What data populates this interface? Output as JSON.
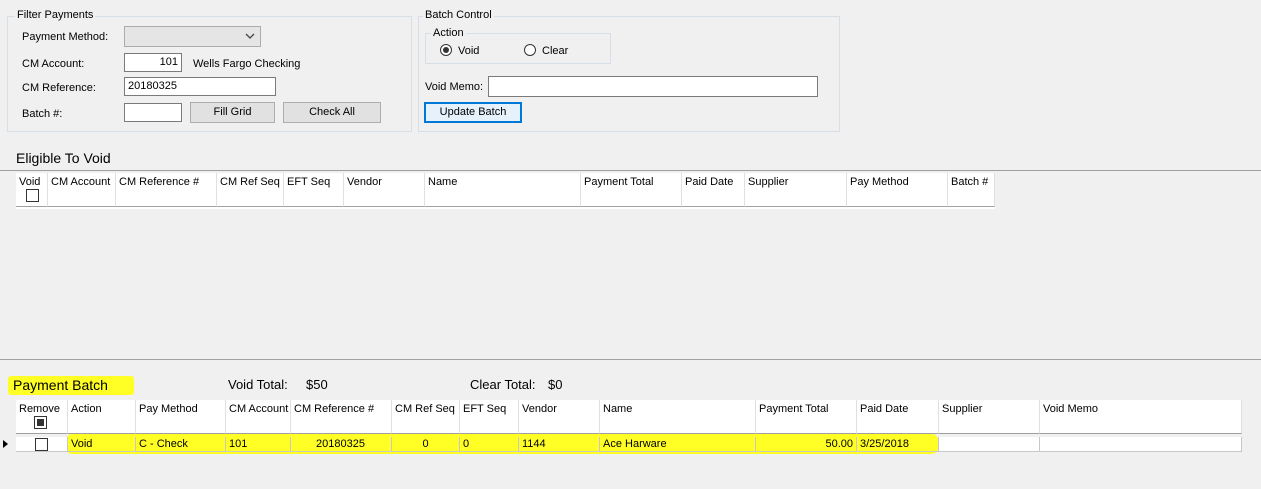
{
  "filter": {
    "legend": "Filter Payments",
    "payment_method_label": "Payment Method:",
    "payment_method_value": "",
    "cm_account_label": "CM Account:",
    "cm_account_value": "101",
    "cm_account_name": "Wells Fargo Checking",
    "cm_reference_label": "CM Reference:",
    "cm_reference_value": "20180325",
    "batch_label": "Batch #:",
    "batch_value": "",
    "fill_grid": "Fill Grid",
    "check_all": "Check All"
  },
  "batch_control": {
    "legend": "Batch Control",
    "action_legend": "Action",
    "void_label": "Void",
    "clear_label": "Clear",
    "selected_action": "Void",
    "void_memo_label": "Void Memo:",
    "void_memo_value": "",
    "update_batch": "Update Batch"
  },
  "eligible": {
    "title": "Eligible To Void",
    "columns": [
      "Void",
      "CM Account",
      "CM Reference #",
      "CM Ref Seq",
      "EFT Seq",
      "Vendor",
      "Name",
      "Payment Total",
      "Paid Date",
      "Supplier",
      "Pay Method",
      "Batch #"
    ]
  },
  "batch": {
    "title": "Payment Batch",
    "void_total_label": "Void Total:",
    "void_total_value": "$50",
    "clear_total_label": "Clear Total:",
    "clear_total_value": "$0",
    "columns": [
      "Remove",
      "Action",
      "Pay Method",
      "CM Account",
      "CM Reference #",
      "CM Ref Seq",
      "EFT Seq",
      "Vendor",
      "Name",
      "Payment Total",
      "Paid Date",
      "Supplier",
      "Void Memo"
    ],
    "rows": [
      {
        "remove": false,
        "action": "Void",
        "pay_method": "C - Check",
        "cm_account": "101",
        "cm_reference": "20180325",
        "cm_ref_seq": "0",
        "eft_seq": "0",
        "vendor": "1144",
        "name": "Ace Harware",
        "payment_total": "50.00",
        "paid_date": "3/25/2018",
        "supplier": "",
        "void_memo": ""
      }
    ]
  },
  "colors": {
    "highlight": "#ffff00",
    "window_bg": "#f0f0f0",
    "focus_blue": "#0078d7"
  }
}
